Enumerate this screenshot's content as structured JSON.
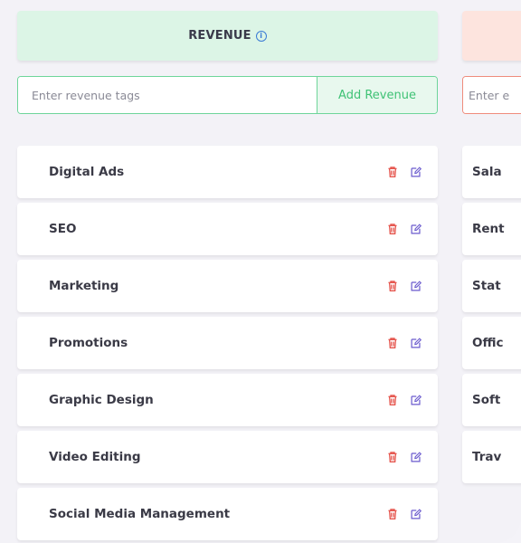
{
  "revenue": {
    "title": "REVENUE",
    "info_icon": "info-icon",
    "input_placeholder": "Enter revenue tags",
    "add_label": "Add Revenue",
    "accent": "#3fc275",
    "header_bg": "#dcf5e6",
    "items": [
      {
        "label": "Digital Ads"
      },
      {
        "label": "SEO"
      },
      {
        "label": "Marketing"
      },
      {
        "label": "Promotions"
      },
      {
        "label": "Graphic Design"
      },
      {
        "label": "Video Editing"
      },
      {
        "label": "Social Media Management"
      }
    ],
    "delete_icon": "trash-icon",
    "edit_icon": "edit-icon",
    "delete_color": "#e5534b",
    "edit_color": "#6a5acd"
  },
  "expense": {
    "header_bg": "#fde4de",
    "input_placeholder_visible": "Enter e",
    "items": [
      {
        "label": "Sala"
      },
      {
        "label": "Rent"
      },
      {
        "label": "Stat"
      },
      {
        "label": "Offic"
      },
      {
        "label": "Soft"
      },
      {
        "label": "Trav"
      }
    ]
  }
}
